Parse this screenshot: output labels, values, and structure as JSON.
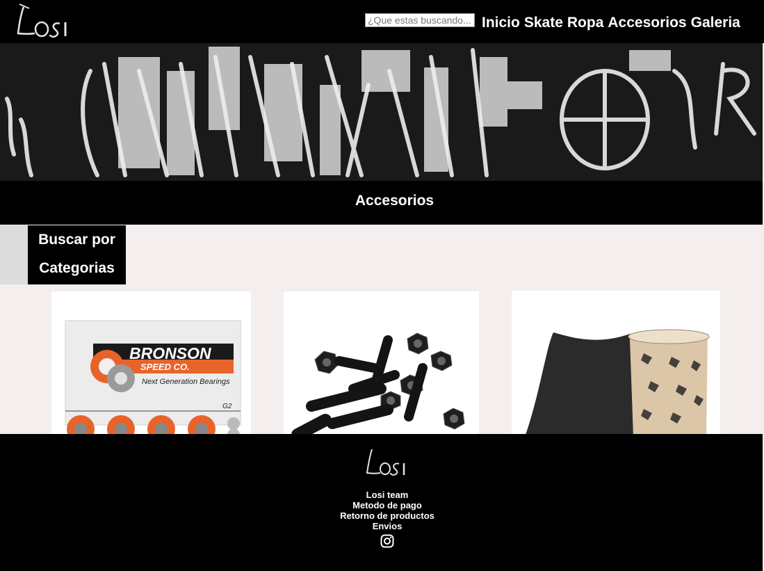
{
  "header": {
    "logo_text": "Losi",
    "search_placeholder": "¿Que estas buscando...",
    "nav": [
      "Inicio",
      "Skate",
      "Ropa",
      "Accesorios",
      "Galeria"
    ]
  },
  "banner": {
    "description_icon": "graffiti-banner-image"
  },
  "section": {
    "title": "Accesorios"
  },
  "filter": {
    "line1": "Buscar por",
    "line2": "Categorias"
  },
  "products": [
    {
      "name": "bearings-product-image",
      "brand_text": "BRONSON",
      "sub_text": "SPEED CO.",
      "tagline": "Next Generation Bearings",
      "model": "G2"
    },
    {
      "name": "hardware-product-image"
    },
    {
      "name": "griptape-product-image"
    }
  ],
  "footer": {
    "logo_text": "Losi",
    "links": [
      "Losi team",
      "Metodo de pago",
      "Retorno de productos",
      "Envios"
    ],
    "social_icon": "instagram-icon"
  },
  "colors": {
    "header_bg": "#000000",
    "page_bg": "#f4eeee",
    "accent_orange": "#e8632a"
  }
}
